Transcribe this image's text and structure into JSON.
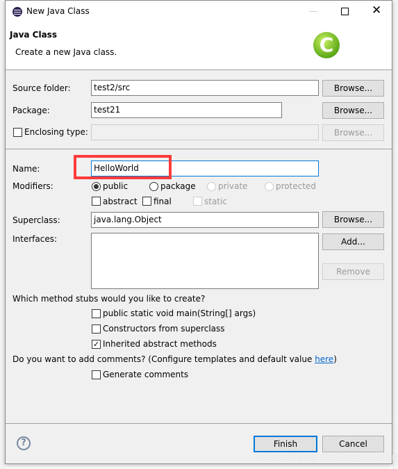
{
  "window": {
    "title": "New Java Class"
  },
  "header": {
    "title": "Java Class",
    "subtitle": "Create a new Java class.",
    "icon": "java-class-c-icon"
  },
  "form": {
    "source_folder": {
      "label": "Source folder:",
      "value": "test2/src",
      "button": "Browse..."
    },
    "package": {
      "label": "Package:",
      "value": "test21",
      "button": "Browse..."
    },
    "enclosing_type": {
      "label": "Enclosing type:",
      "value": "",
      "checked": false,
      "button": "Browse..."
    },
    "name": {
      "label": "Name:",
      "value": "HelloWorld"
    },
    "modifiers": {
      "label": "Modifiers:",
      "radios": [
        {
          "label": "public",
          "selected": true,
          "enabled": true
        },
        {
          "label": "package",
          "selected": false,
          "enabled": true
        },
        {
          "label": "private",
          "selected": false,
          "enabled": false
        },
        {
          "label": "protected",
          "selected": false,
          "enabled": false
        }
      ],
      "checks": [
        {
          "label": "abstract",
          "checked": false,
          "enabled": true
        },
        {
          "label": "final",
          "checked": false,
          "enabled": true
        },
        {
          "label": "static",
          "checked": false,
          "enabled": false
        }
      ]
    },
    "superclass": {
      "label": "Superclass:",
      "value": "java.lang.Object",
      "button": "Browse..."
    },
    "interfaces": {
      "label": "Interfaces:",
      "add": "Add...",
      "remove": "Remove"
    },
    "stubs": {
      "question": "Which method stubs would you like to create?",
      "options": [
        {
          "label": "public static void main(String[] args)",
          "checked": false
        },
        {
          "label": "Constructors from superclass",
          "checked": false
        },
        {
          "label": "Inherited abstract methods",
          "checked": true
        }
      ]
    },
    "comments": {
      "question_pre": "Do you want to add comments? (Configure templates and default value ",
      "link": "here",
      "question_post": ")",
      "option": "Generate comments",
      "checked": false
    }
  },
  "footer": {
    "finish": "Finish",
    "cancel": "Cancel"
  },
  "watermark": "https://blog.csdn.net/funzmg",
  "colors": {
    "highlight": "#ff3b3b",
    "link": "#0066cc",
    "focus": "#0078d7"
  }
}
